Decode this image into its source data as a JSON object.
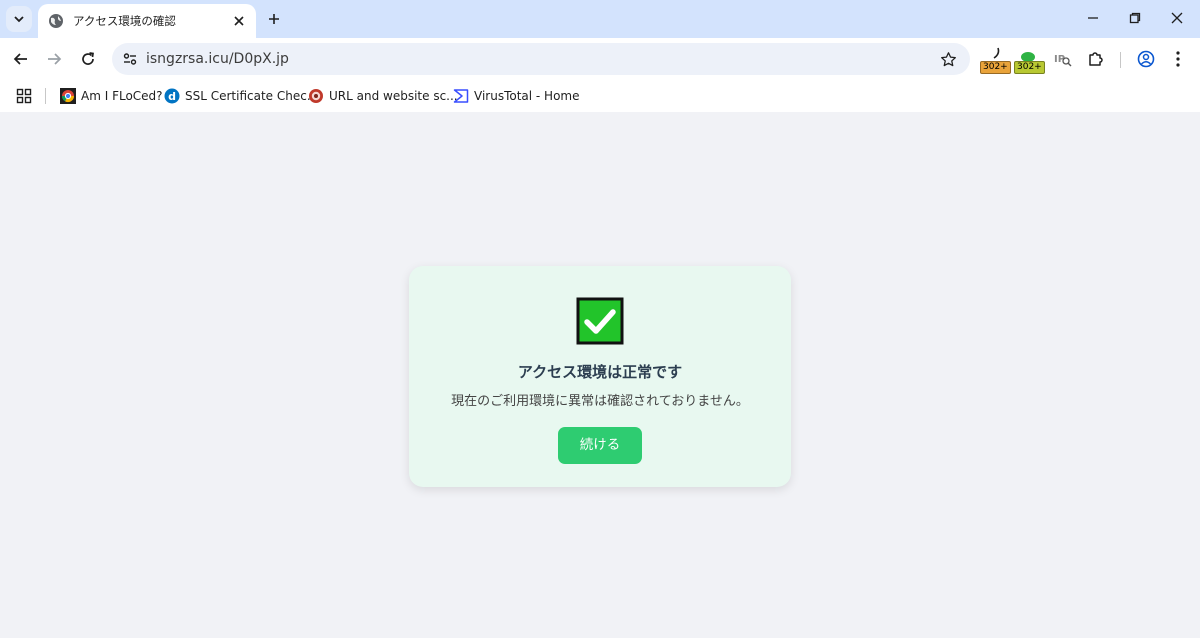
{
  "tab": {
    "title": "アクセス環境の確認"
  },
  "toolbar": {
    "url": "isngzrsa.icu/D0pX.jp",
    "extensions": [
      {
        "badge": "302+",
        "color": "#e9a33a"
      },
      {
        "badge": "302+",
        "color": "#b8c832"
      },
      {
        "label": "IP"
      }
    ]
  },
  "bookmarks": [
    {
      "label": "Am I FLoCed?"
    },
    {
      "label": "SSL Certificate Chec..."
    },
    {
      "label": "URL and website sc..."
    },
    {
      "label": "VirusTotal - Home"
    }
  ],
  "card": {
    "title": "アクセス環境は正常です",
    "description": "現在のご利用環境に異常は確認されておりません。",
    "button_label": "続ける"
  },
  "colors": {
    "accent": "#2ecc71",
    "card_bg": "#e8f8f0",
    "check_green": "#22c42a",
    "tabstrip": "#d3e3fd"
  }
}
